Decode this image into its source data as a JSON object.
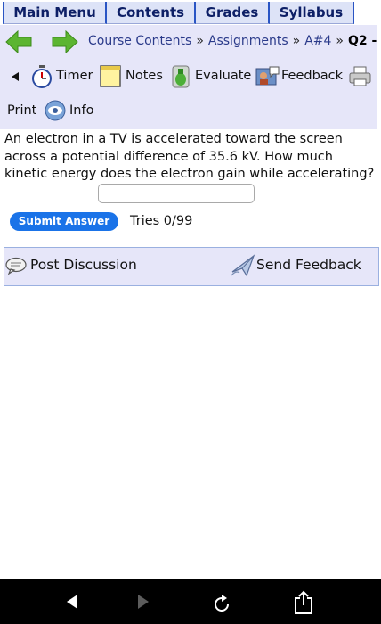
{
  "nav_tabs": [
    "Main Menu",
    "Contents",
    "Grades",
    "Syllabus"
  ],
  "breadcrumb": {
    "items": [
      "Course Contents",
      "Assignments",
      "A#4"
    ],
    "current": "Q2 -",
    "separator": "»"
  },
  "toolbar": {
    "timer": "Timer",
    "notes": "Notes",
    "evaluate": "Evaluate",
    "feedback": "Feedback",
    "print": "Print",
    "info": "Info"
  },
  "question": {
    "text": "An electron in a TV is accelerated toward the screen across a potential difference of 35.6 kV. How much kinetic energy does the electron gain while accelerating?",
    "answer_value": "",
    "submit_label": "Submit Answer",
    "tries": "Tries 0/99"
  },
  "discussion": {
    "post_label": "Post Discussion",
    "send_label": "Send Feedback"
  },
  "colors": {
    "header_bg": "#e6e6f9",
    "tab_bg": "#dde3f7",
    "tab_text": "#0d1f66",
    "submit_bg": "#1a73e8",
    "green_arrow": "#5cb531"
  }
}
